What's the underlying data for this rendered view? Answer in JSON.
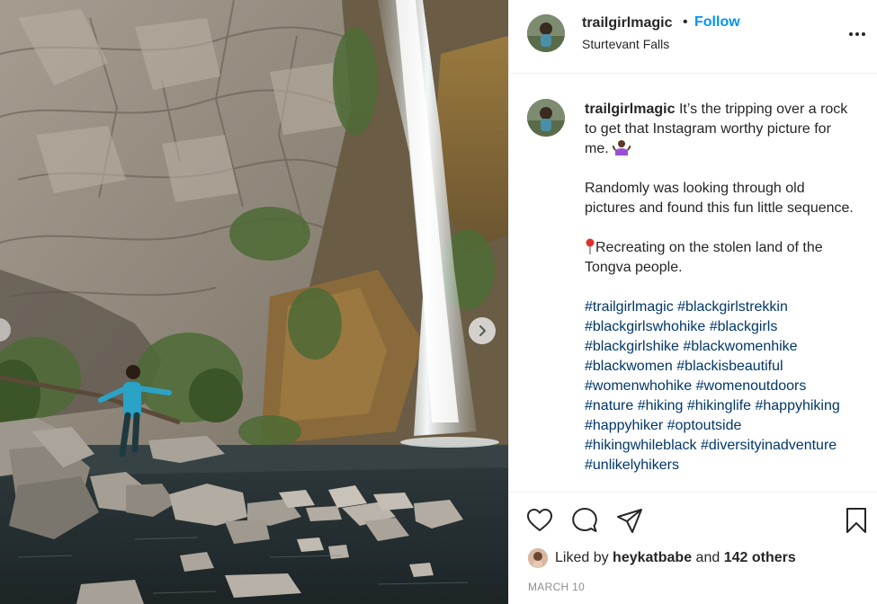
{
  "post": {
    "username": "trailgirlmagic",
    "separator": "•",
    "follow_label": "Follow",
    "location": "Sturtevant Falls",
    "more_icon": "more-horizontal-icon"
  },
  "caption": {
    "username": "trailgirlmagic",
    "line1": "It’s the tripping over a rock to get that Instagram worthy picture for me.",
    "line1_emoji": "person-shrugging-emoji",
    "para2": "Randomly was looking through old pictures and found this fun little sequence.",
    "para3_emoji": "round-pushpin-emoji",
    "para3": "Recreating on the stolen land of the Tongva people.",
    "hashtags": [
      "#trailgirlmagic",
      "#blackgirlstrekkin",
      "#blackgirlswhohike",
      "#blackgirls",
      "#blackgirlshike",
      "#blackwomenhike",
      "#blackwomen",
      "#blackisbeautiful",
      "#womenwhohike",
      "#womenoutdoors",
      "#nature",
      "#hiking",
      "#hikinglife",
      "#happyhiking",
      "#happyhiker",
      "#optoutside",
      "#hikingwhileblack",
      "#diversityinadventure",
      "#unlikelyhikers"
    ]
  },
  "actions": {
    "like_icon": "heart-icon",
    "comment_icon": "comment-icon",
    "share_icon": "paper-plane-icon",
    "save_icon": "bookmark-icon"
  },
  "likes": {
    "prefix": "Liked by",
    "user": "heykatbabe",
    "and": "and",
    "others": "142 others"
  },
  "date": "MARCH 10",
  "colors": {
    "follow": "#0095f6",
    "hashtag": "#00376b",
    "text": "#262626",
    "muted": "#8e8e8e",
    "divider": "#efefef"
  }
}
